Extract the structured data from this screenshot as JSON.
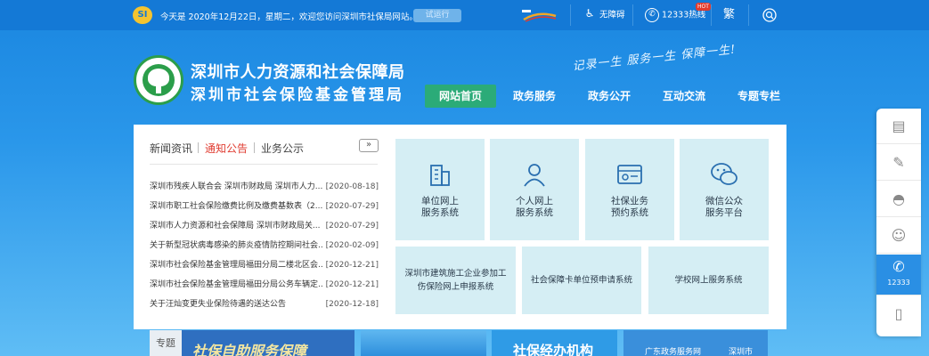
{
  "topbar": {
    "logo_text": "SI",
    "welcome": "今天是 2020年12月22日，星期二，欢迎您访问深圳市社保局网站。",
    "trial": "试运行",
    "accessibility": "无障碍",
    "hotline": "12333热线",
    "hot_badge": "HOT",
    "traditional": "繁",
    "search_icon": "search-icon"
  },
  "header": {
    "org_name_1": "深圳市人力资源和社会保障局",
    "org_name_2": "深圳市社会保险基金管理局",
    "slogan": "记录一生  服务一生  保障一生!"
  },
  "nav": {
    "items": [
      {
        "label": "网站首页",
        "active": true
      },
      {
        "label": "政务服务",
        "active": false
      },
      {
        "label": "政务公开",
        "active": false
      },
      {
        "label": "互动交流",
        "active": false
      },
      {
        "label": "专题专栏",
        "active": false
      }
    ]
  },
  "news": {
    "tabs": [
      {
        "label": "新闻资讯",
        "active": false
      },
      {
        "label": "通知公告",
        "active": true
      },
      {
        "label": "业务公示",
        "active": false
      }
    ],
    "more": "»",
    "items": [
      {
        "title": "深圳市残疾人联合会 深圳市财政局 深圳市人力...",
        "date": "[2020-08-18]"
      },
      {
        "title": "深圳市职工社会保险缴费比例及缴费基数表（2...",
        "date": "[2020-07-29]"
      },
      {
        "title": "深圳市人力资源和社会保障局 深圳市财政局关...",
        "date": "[2020-07-29]"
      },
      {
        "title": "关于新型冠状病毒感染的肺炎疫情防控期间社会...",
        "date": "[2020-02-09]"
      },
      {
        "title": "深圳市社会保险基金管理局福田分局二楼北区会...",
        "date": "[2020-12-21]"
      },
      {
        "title": "深圳市社会保险基金管理局福田分局公务车辆定...",
        "date": "[2020-12-21]"
      },
      {
        "title": "关于汪灿变更失业保险待遇的送达公告",
        "date": "[2020-12-18]"
      }
    ]
  },
  "services": {
    "top": [
      {
        "line1": "单位网上",
        "line2": "服务系统",
        "icon": "building-icon"
      },
      {
        "line1": "个人网上",
        "line2": "服务系统",
        "icon": "person-icon"
      },
      {
        "line1": "社保业务",
        "line2": "预约系统",
        "icon": "calendar-icon"
      },
      {
        "line1": "微信公众",
        "line2": "服务平台",
        "icon": "wechat-icon"
      }
    ],
    "bottom": [
      {
        "label": "深圳市建筑施工企业参加工伤保险网上申报系统"
      },
      {
        "label": "社会保障卡单位预申请系统"
      },
      {
        "label": "学校网上服务系统"
      }
    ]
  },
  "sidebar": {
    "items": [
      {
        "icon": "document-icon",
        "label": ""
      },
      {
        "icon": "edit-icon",
        "label": ""
      },
      {
        "icon": "wechat-icon",
        "label": ""
      },
      {
        "icon": "robot-icon",
        "label": ""
      },
      {
        "icon": "phone-icon",
        "label": "12333"
      },
      {
        "icon": "mobile-icon",
        "label": ""
      }
    ]
  },
  "banners": {
    "topic_label": "专题",
    "social_security": "社保自助服务保障",
    "agency": "社保经办机构",
    "gov_portal": "广东政务服务网",
    "gov_city": "深圳市"
  },
  "colors": {
    "topbar": "#1479d6",
    "active_nav": "#2bab78",
    "alert_tab": "#e03c31",
    "tile_bg": "#d5eef4",
    "sidebar_active": "#2a8fe4"
  }
}
